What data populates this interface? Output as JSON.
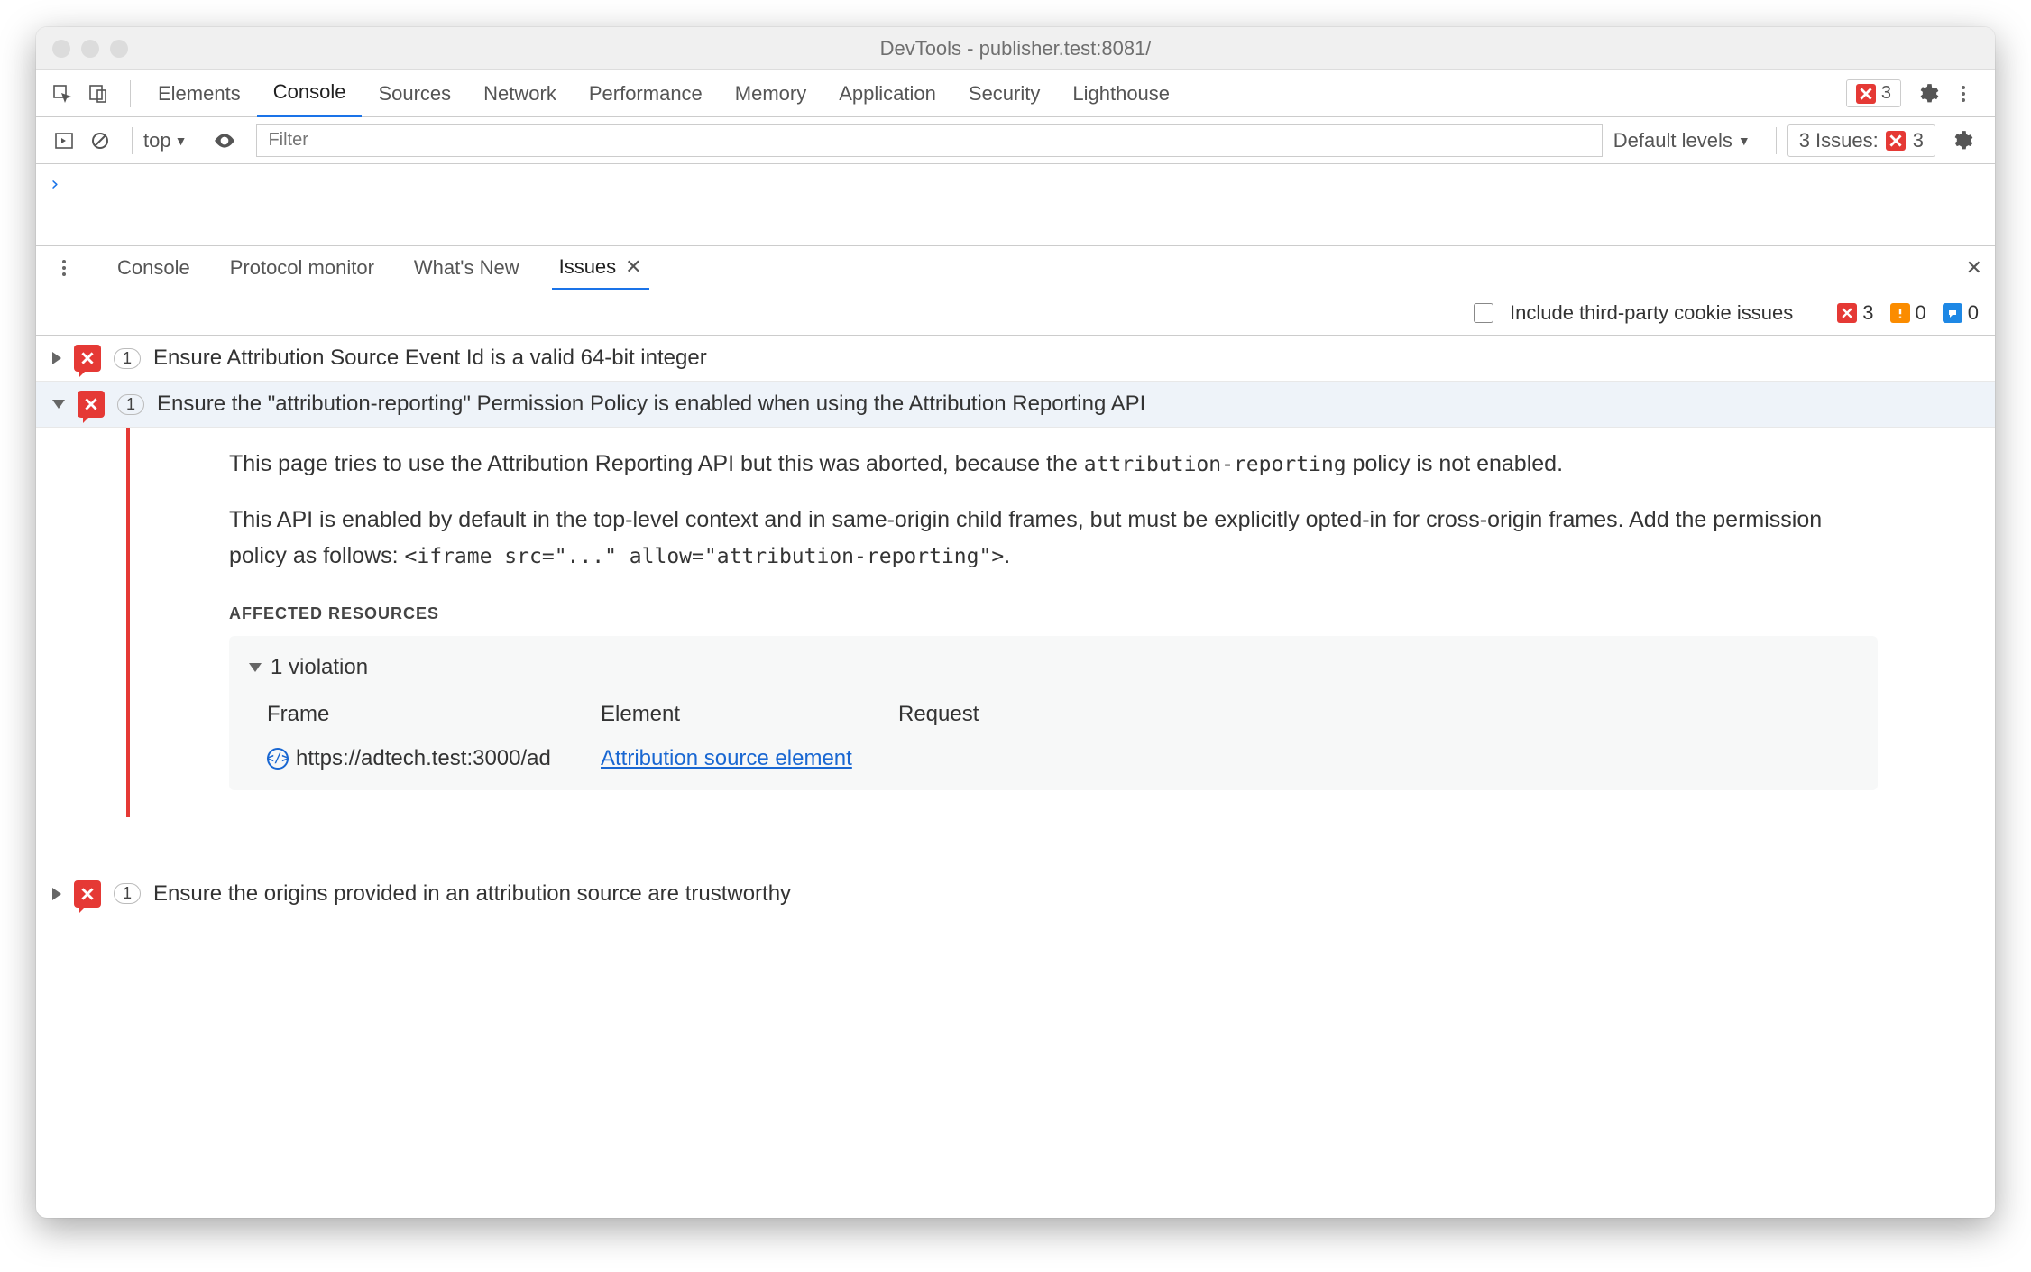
{
  "window": {
    "title": "DevTools - publisher.test:8081/"
  },
  "tabs": [
    "Elements",
    "Console",
    "Sources",
    "Network",
    "Performance",
    "Memory",
    "Application",
    "Security",
    "Lighthouse"
  ],
  "tabs_active": "Console",
  "top_error_count": "3",
  "toolbar": {
    "context": "top",
    "filter_placeholder": "Filter",
    "levels": "Default levels",
    "issues_label": "3 Issues:",
    "issues_count": "3"
  },
  "drawer": {
    "tabs": [
      "Console",
      "Protocol monitor",
      "What's New",
      "Issues"
    ],
    "active": "Issues"
  },
  "drawer_sub": {
    "checkbox_label": "Include third-party cookie issues",
    "counts": {
      "red": "3",
      "orange": "0",
      "blue": "0"
    }
  },
  "issues": [
    {
      "count": "1",
      "title": "Ensure Attribution Source Event Id is a valid 64-bit integer",
      "expanded": false
    },
    {
      "count": "1",
      "title": "Ensure the \"attribution-reporting\" Permission Policy is enabled when using the Attribution Reporting API",
      "expanded": true
    },
    {
      "count": "1",
      "title": "Ensure the origins provided in an attribution source are trustworthy",
      "expanded": false
    }
  ],
  "issue_body": {
    "p1a": "This page tries to use the Attribution Reporting API but this was aborted, because the ",
    "p1code": "attribution-reporting",
    "p1b": " policy is not enabled.",
    "p2a": "This API is enabled by default in the top-level context and in same-origin child frames, but must be explicitly opted-in for cross-origin frames. Add the permission policy as follows: ",
    "p2code": "<iframe src=\"...\" allow=\"attribution-reporting\">",
    "p2b": ".",
    "section_label": "Affected Resources",
    "violation_label": "1 violation",
    "cols": [
      "Frame",
      "Element",
      "Request"
    ],
    "row": {
      "frame": "https://adtech.test:3000/ad",
      "element": "Attribution source element"
    }
  }
}
